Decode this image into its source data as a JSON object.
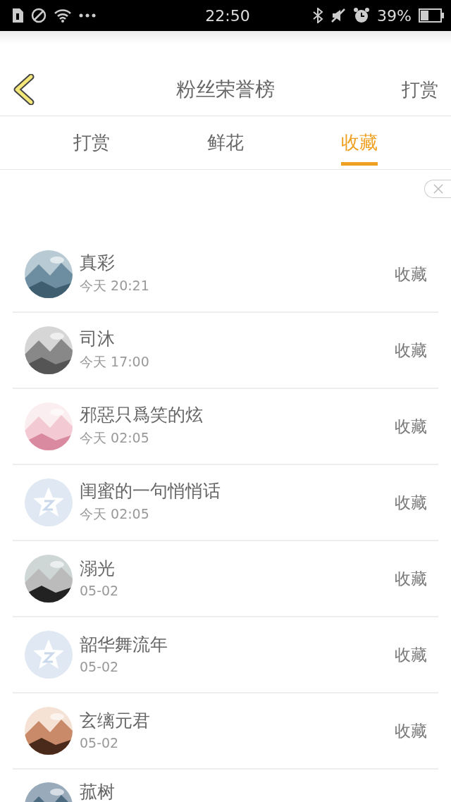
{
  "status_bar": {
    "time": "22:50",
    "battery": "39%"
  },
  "header": {
    "title": "粉丝荣誉榜",
    "action": "打赏"
  },
  "tabs": [
    {
      "label": "打赏",
      "selected": false
    },
    {
      "label": "鲜花",
      "selected": false
    },
    {
      "label": "收藏",
      "selected": true
    }
  ],
  "fans": [
    {
      "name": "真彩",
      "time": "今天 20:21",
      "action": "收藏"
    },
    {
      "name": "司沐",
      "time": "今天 17:00",
      "action": "收藏"
    },
    {
      "name": "邪惡只爲笑的炫",
      "time": "今天 02:05",
      "action": "收藏"
    },
    {
      "name": "闺蜜的一句悄悄话",
      "time": "今天 02:05",
      "action": "收藏",
      "avatar": {
        "kind": "default"
      }
    },
    {
      "name": "溺光",
      "time": "05-02",
      "action": "收藏"
    },
    {
      "name": "韶华舞流年",
      "time": "05-02",
      "action": "收藏",
      "avatar": {
        "kind": "default"
      }
    },
    {
      "name": "玄缡元君",
      "time": "05-02",
      "action": "收藏"
    },
    {
      "name": "菰树"
    }
  ]
}
